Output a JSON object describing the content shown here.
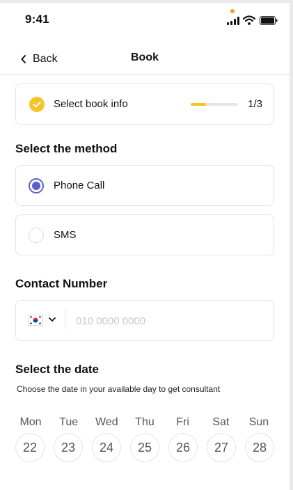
{
  "status_bar": {
    "time": "9:41"
  },
  "nav": {
    "back_label": "Back",
    "title": "Book"
  },
  "step": {
    "label": "Select book info",
    "count": "1/3",
    "progress": 0.33
  },
  "method": {
    "title": "Select the method",
    "options": [
      {
        "label": "Phone Call",
        "selected": true
      },
      {
        "label": "SMS",
        "selected": false
      }
    ]
  },
  "contact": {
    "title": "Contact Number",
    "country_flag": "kr-flag-icon",
    "placeholder": "010 0000 0000"
  },
  "date": {
    "title": "Select the date",
    "subtitle": "Choose the date in your available day to get consultant",
    "days": [
      "Mon",
      "Tue",
      "Wed",
      "Thu",
      "Fri",
      "Sat",
      "Sun"
    ],
    "dates": [
      "22",
      "23",
      "24",
      "25",
      "26",
      "27",
      "28"
    ]
  },
  "colors": {
    "accent": "#5a5fd0",
    "highlight": "#f7c325",
    "border": "#e3e3e6"
  }
}
